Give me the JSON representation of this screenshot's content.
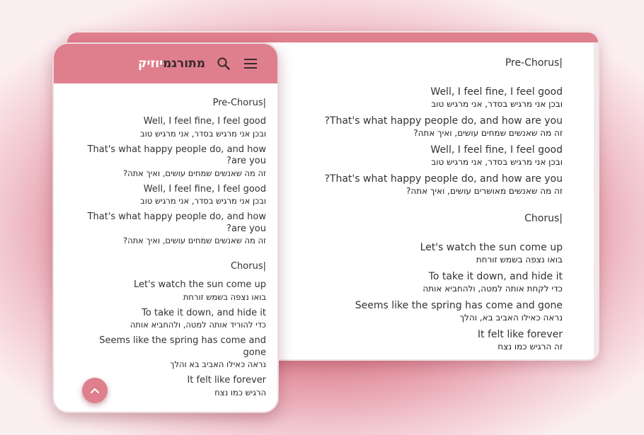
{
  "app": {
    "brand_prefix": "מתורגמ",
    "brand_accent": "יוזיק"
  },
  "colors": {
    "accent": "#df7f8d",
    "background": "#df8896",
    "card": "#ffffff"
  },
  "icons": {
    "menu": "menu-icon",
    "search": "search-icon",
    "scroll_top": "chevron-up-icon"
  },
  "desktop": {
    "sections": [
      {
        "label": "|Pre-Chorus",
        "lines": [
          {
            "en": "Well, I feel fine, I feel good",
            "he": "ובכן אני מרגיש בסדר, אני מרגיש טוב"
          },
          {
            "en": "That's what happy people do, and how are you?",
            "he": "זה מה שאנשים שמחים עושים, ואיך אתה?"
          },
          {
            "en": "Well, I feel fine, I feel good",
            "he": "ובכן אני מרגיש בסדר, אני מרגיש טוב"
          },
          {
            "en": "That's what happy people do, and how are you?",
            "he": "זה מה שאנשים מאושרים עושים, ואיך אתה?"
          }
        ]
      },
      {
        "label": "|Chorus",
        "lines": [
          {
            "en": "Let's watch the sun come up",
            "he": "בואו נצפה בשמש זורחת"
          },
          {
            "en": "To take it down, and hide it",
            "he": "כדי לקחת אותה למטה, ולהחביא אותה"
          },
          {
            "en": "Seems like the spring has come and gone",
            "he": "נראה כאילו האביב בא, והלך"
          },
          {
            "en": "It felt like forever",
            "he": "זה הרגיש כמו נצח"
          }
        ]
      }
    ]
  },
  "mobile": {
    "sections": [
      {
        "label": "|Pre-Chorus",
        "lines": [
          {
            "en": "Well, I feel fine, I feel good",
            "he": "ובכן אני מרגיש בסדר, אני מרגיש טוב"
          },
          {
            "en": "That's what happy people do, and how are you?",
            "he": "זה מה שאנשים שמחים עושים, ואיך אתה?"
          },
          {
            "en": "Well, I feel fine, I feel good",
            "he": "ובכן אני מרגיש בסדר, אני מרגיש טוב"
          },
          {
            "en": "That's what happy people do, and how are you?",
            "he": "זה מה שאנשים שמחים עושים, ואיך אתה?"
          }
        ]
      },
      {
        "label": "|Chorus",
        "lines": [
          {
            "en": "Let's watch the sun come up",
            "he": "בואו נצפה בשמש זורחת"
          },
          {
            "en": "To take it down, and hide it",
            "he": "כדי להוריד אותה למטה, ולהחביא אותה"
          },
          {
            "en": "Seems like the spring has come and gone",
            "he": "נראה כאילו האביב בא והלך"
          },
          {
            "en": "It felt like forever",
            "he": "הרגיש כמו נצח"
          }
        ]
      }
    ]
  }
}
